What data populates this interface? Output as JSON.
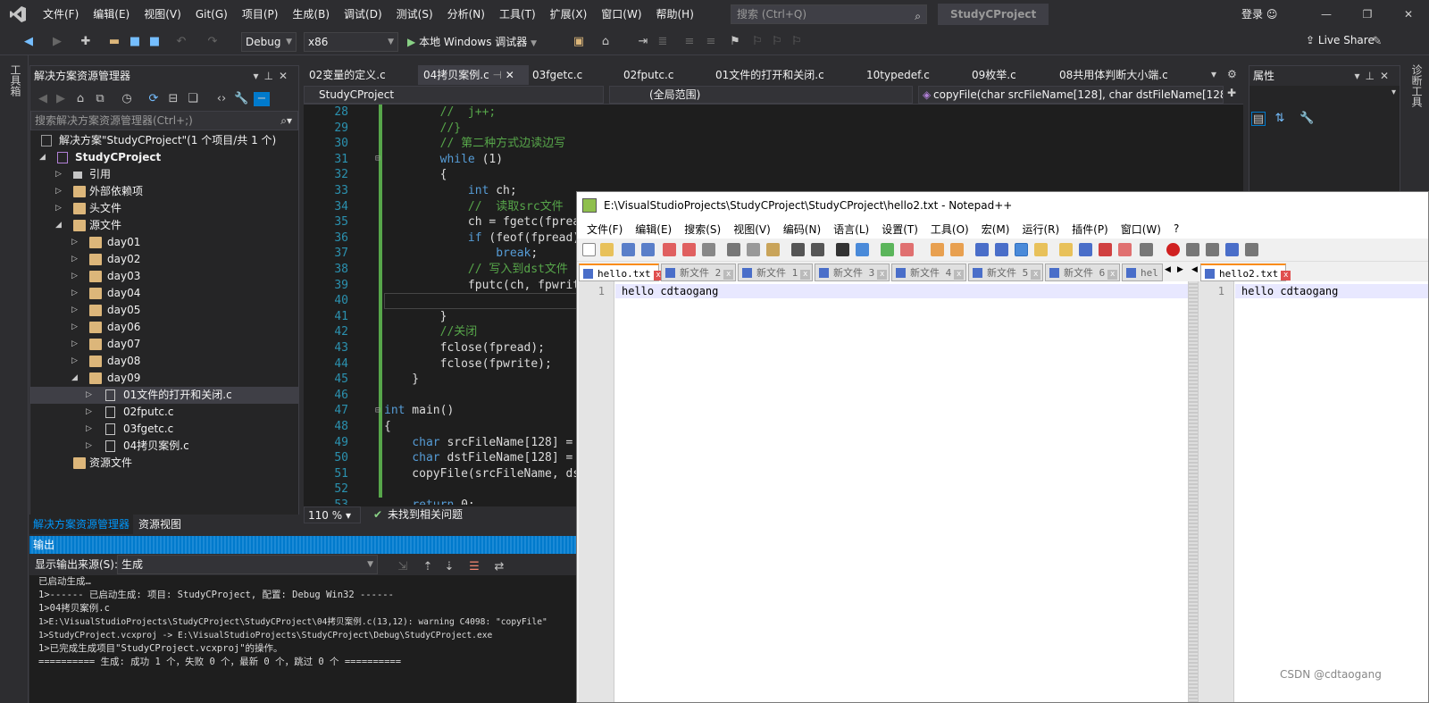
{
  "menubar": {
    "items": [
      "文件(F)",
      "编辑(E)",
      "视图(V)",
      "Git(G)",
      "项目(P)",
      "生成(B)",
      "调试(D)",
      "测试(S)",
      "分析(N)",
      "工具(T)",
      "扩展(X)",
      "窗口(W)",
      "帮助(H)"
    ],
    "search_placeholder": "搜索 (Ctrl+Q)",
    "project_name": "StudyCProject",
    "login": "登录"
  },
  "toolbar": {
    "config": "Debug",
    "platform": "x86",
    "run_label": "本地 Windows 调试器",
    "live_share": "Live Share"
  },
  "side_strips": {
    "left": "工具箱",
    "right": "诊断工具"
  },
  "solution_explorer": {
    "title": "解决方案资源管理器",
    "search_placeholder": "搜索解决方案资源管理器(Ctrl+;)",
    "solution": "解决方案\"StudyCProject\"(1 个项目/共 1 个)",
    "project": "StudyCProject",
    "refs": "引用",
    "ext_deps": "外部依赖项",
    "headers": "头文件",
    "sources": "源文件",
    "days": [
      "day01",
      "day02",
      "day03",
      "day04",
      "day05",
      "day06",
      "day07",
      "day08",
      "day09"
    ],
    "day09_files": [
      "01文件的打开和关闭.c",
      "02fputc.c",
      "03fgetc.c",
      "04拷贝案例.c"
    ],
    "resources": "资源文件",
    "bottom_tabs": [
      "解决方案资源管理器",
      "资源视图"
    ]
  },
  "editor": {
    "tabs": [
      "02变量的定义.c",
      "04拷贝案例.c",
      "03fgetc.c",
      "02fputc.c",
      "01文件的打开和关闭.c",
      "10typedef.c",
      "09枚举.c",
      "08共用体判断大小端.c"
    ],
    "nav_project": "StudyCProject",
    "nav_scope": "(全局范围)",
    "nav_function": "copyFile(char srcFileName[128], char dstFileName[128",
    "zoom": "110 %",
    "status": "未找到相关问题",
    "line_numbers": [
      "28",
      "29",
      "30",
      "31",
      "32",
      "33",
      "34",
      "35",
      "36",
      "37",
      "38",
      "39",
      "40",
      "41",
      "42",
      "43",
      "44",
      "45",
      "46",
      "47",
      "48",
      "49",
      "50",
      "51",
      "52",
      "53"
    ]
  },
  "properties": {
    "title": "属性"
  },
  "output": {
    "title": "输出",
    "source_label": "显示输出来源(S):",
    "source_value": "生成",
    "lines": [
      "已启动生成…",
      "1>------ 已启动生成: 项目: StudyCProject, 配置: Debug Win32 ------",
      "1>04拷贝案例.c",
      "1>E:\\VisualStudioProjects\\StudyCProject\\StudyCProject\\04拷贝案例.c(13,12): warning C4098: \"copyFile\"",
      "1>StudyCProject.vcxproj -> E:\\VisualStudioProjects\\StudyCProject\\Debug\\StudyCProject.exe",
      "1>已完成生成项目\"StudyCProject.vcxproj\"的操作。",
      "========== 生成: 成功 1 个，失败 0 个，最新 0 个，跳过 0 个 =========="
    ]
  },
  "notepad": {
    "title": "E:\\VisualStudioProjects\\StudyCProject\\StudyCProject\\hello2.txt - Notepad++",
    "menu": [
      "文件(F)",
      "编辑(E)",
      "搜索(S)",
      "视图(V)",
      "编码(N)",
      "语言(L)",
      "设置(T)",
      "工具(O)",
      "宏(M)",
      "运行(R)",
      "插件(P)",
      "窗口(W)",
      "?"
    ],
    "left_tabs": [
      "hello.txt",
      "新文件 2",
      "新文件 1",
      "新文件 3",
      "新文件 4",
      "新文件 5",
      "新文件 6",
      "hel"
    ],
    "right_tab": "hello2.txt",
    "line_no": "1",
    "left_content": "hello cdtaogang",
    "right_content": "hello cdtaogang"
  },
  "watermark": "CSDN @cdtaogang"
}
